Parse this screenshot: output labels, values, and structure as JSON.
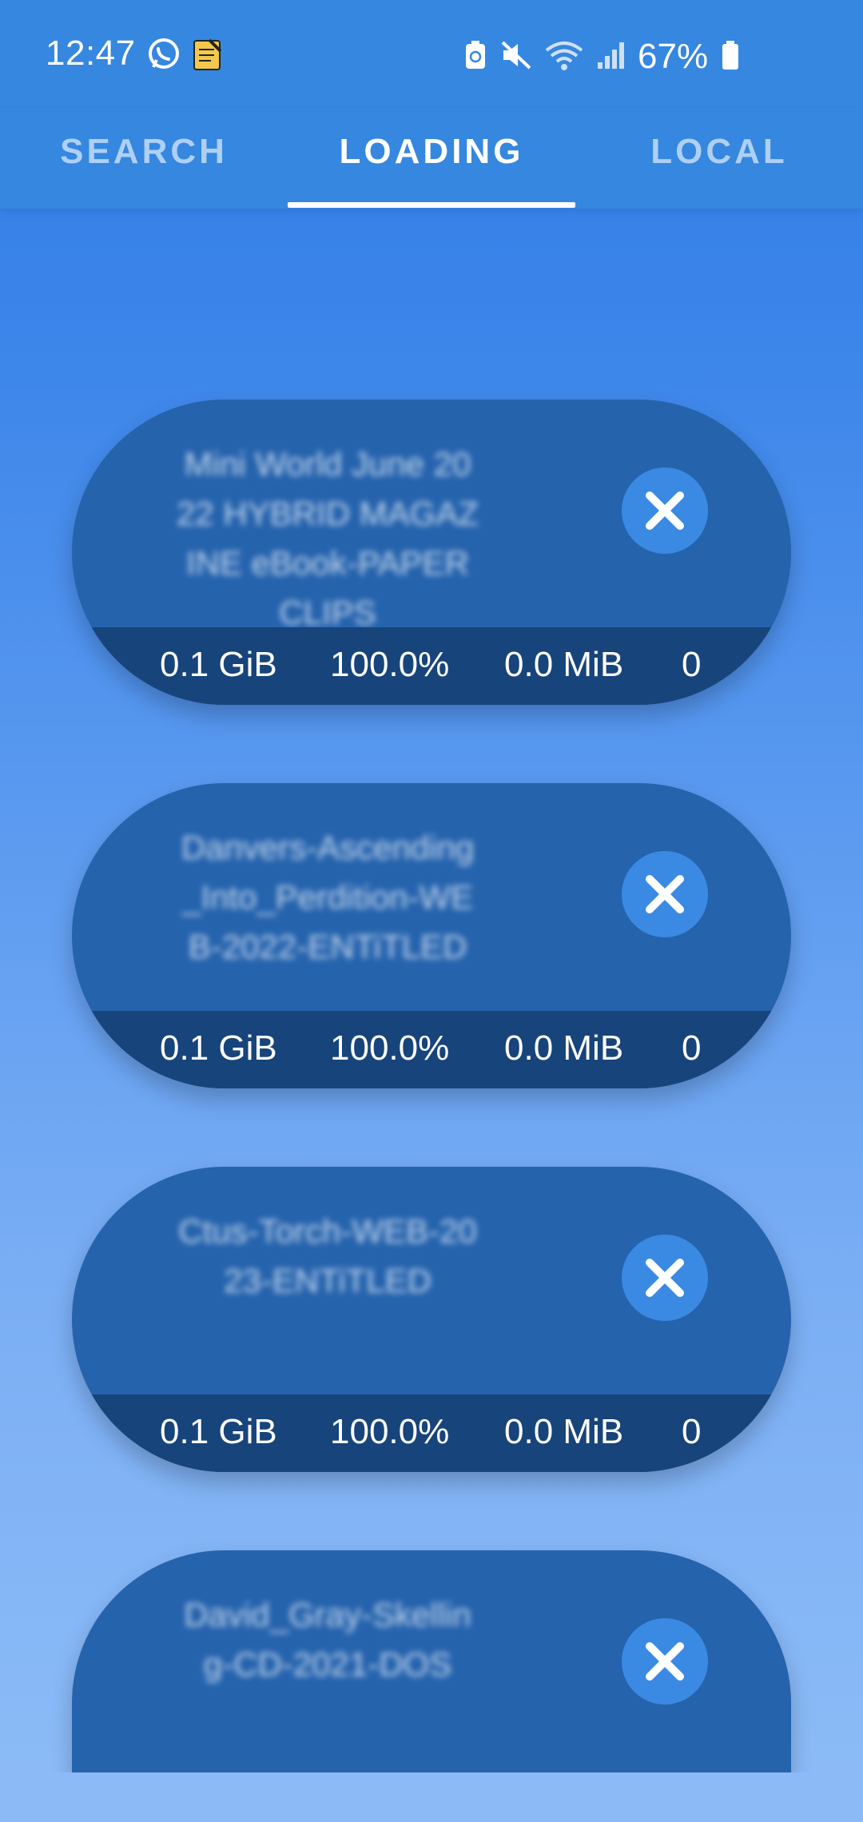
{
  "status_bar": {
    "time": "12:47",
    "battery_percent": "67%",
    "icons": [
      "whatsapp-icon",
      "notes-app-icon",
      "battery-saver-icon",
      "mute-icon",
      "wifi-icon",
      "signal-icon",
      "battery-icon"
    ]
  },
  "tabs": [
    {
      "label": "SEARCH",
      "active": false
    },
    {
      "label": "LOADING",
      "active": true
    },
    {
      "label": "LOCAL",
      "active": false
    }
  ],
  "downloads": [
    {
      "title": "Mini World June 2022 HYBRID MAGAZINE eBook-PAPERCLIPS",
      "size": "0.1 GiB",
      "progress": "100.0%",
      "speed": "0.0 MiB",
      "peers": "0"
    },
    {
      "title": "Danvers-Ascending_Into_Perdition-WEB-2022-ENTiTLED",
      "size": "0.1 GiB",
      "progress": "100.0%",
      "speed": "0.0 MiB",
      "peers": "0"
    },
    {
      "title": "Ctus-Torch-WEB-2023-ENTiTLED",
      "size": "0.1 GiB",
      "progress": "100.0%",
      "speed": "0.0 MiB",
      "peers": "0"
    },
    {
      "title": "David_Gray-Skelling-CD-2021-DOS",
      "size": "",
      "progress": "",
      "speed": "",
      "peers": ""
    }
  ]
}
